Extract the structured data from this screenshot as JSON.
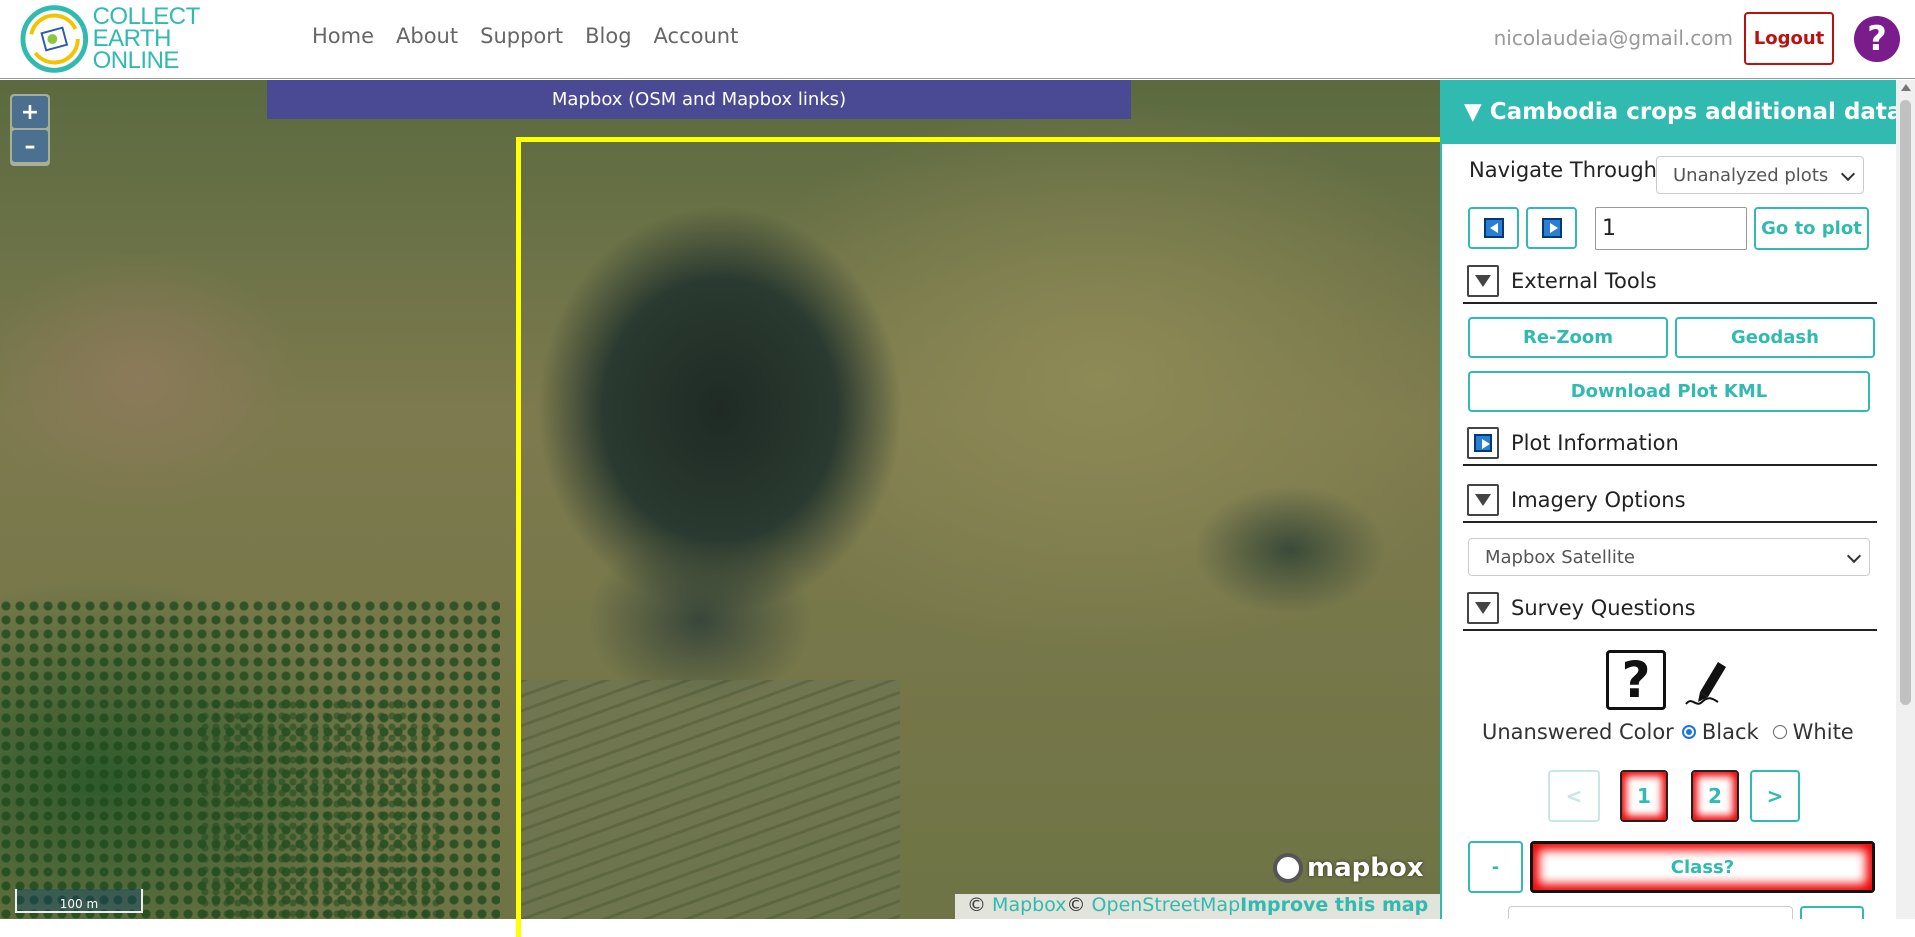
{
  "navbar": {
    "logo_line1": "COLLECT EARTH",
    "logo_line2": "ONLINE",
    "links": [
      "Home",
      "About",
      "Support",
      "Blog",
      "Account"
    ],
    "user_email": "nicolaudeia@gmail.com",
    "logout_label": "Logout",
    "help_label": "?"
  },
  "map": {
    "zoom_in": "+",
    "zoom_out": "–",
    "imagery_banner": "Mapbox (OSM and Mapbox links)",
    "mapbox_logo": "mapbox",
    "attribution": {
      "copy1": "© ",
      "mapbox_link": "Mapbox",
      "copy2": "© ",
      "osm_link": "OpenStreetMap",
      "improve_link": "Improve this map"
    },
    "scale_label": "100 m",
    "plot_boundary_color": "#ffff00"
  },
  "panel": {
    "title": "▼ Cambodia crops additional data c...",
    "navigate_label": "Navigate Through:",
    "navigate_select": "Unanalyzed plots",
    "plot_number": "1",
    "go_to_plot": "Go to plot",
    "sections": {
      "external_tools": "External Tools",
      "plot_information": "Plot Information",
      "imagery_options": "Imagery Options",
      "survey_questions": "Survey Questions"
    },
    "rezoom": "Re-Zoom",
    "geodash": "Geodash",
    "download_kml": "Download Plot KML",
    "imagery_select": "Mapbox Satellite",
    "question_icon": "?",
    "unanswered_color_label": "Unanswered Color",
    "color_options": [
      "Black",
      "White"
    ],
    "selected_color": "Black",
    "pages": {
      "prev": "<",
      "p1": "1",
      "p2": "2",
      "next": ">"
    },
    "minus_label": "-",
    "class_label": "Class?"
  },
  "colors": {
    "accent": "#31BAB0",
    "banner": "#4a4a94",
    "logout": "#bb1111",
    "help": "#7a1c8c",
    "unanswered_highlight": "#ee0000"
  }
}
